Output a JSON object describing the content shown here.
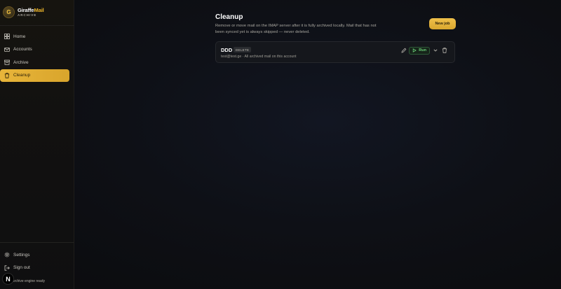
{
  "brand": {
    "logo_letter": "G",
    "name_part1": "Giraffe",
    "name_part2": "Mail",
    "subtitle": "ARCHIVE"
  },
  "sidebar": {
    "items": [
      {
        "label": "Home",
        "icon": "home-icon",
        "active": false
      },
      {
        "label": "Accounts",
        "icon": "mail-icon",
        "active": false
      },
      {
        "label": "Archive",
        "icon": "archive-icon",
        "active": false
      },
      {
        "label": "Cleanup",
        "icon": "trash-icon",
        "active": true
      }
    ],
    "bottom_items": [
      {
        "label": "Settings",
        "icon": "gear-icon"
      },
      {
        "label": "Sign out",
        "icon": "sign-out-icon"
      }
    ],
    "status_text": "Archive engine ready",
    "status_badge": "N"
  },
  "main": {
    "title": "Cleanup",
    "description": "Remove or move mail on the IMAP server after it is fully archived locally. Mail that has not been synced yet is always skipped — never deleted.",
    "new_job_label": "New job",
    "jobs": [
      {
        "name": "DDD",
        "badge": "DELETE",
        "meta": "test@test.ge · All archived mail on this account",
        "run_label": "Run"
      }
    ]
  },
  "colors": {
    "accent": "#e8b53a",
    "run_green": "#6bd47a",
    "background": "#0c0d10"
  }
}
